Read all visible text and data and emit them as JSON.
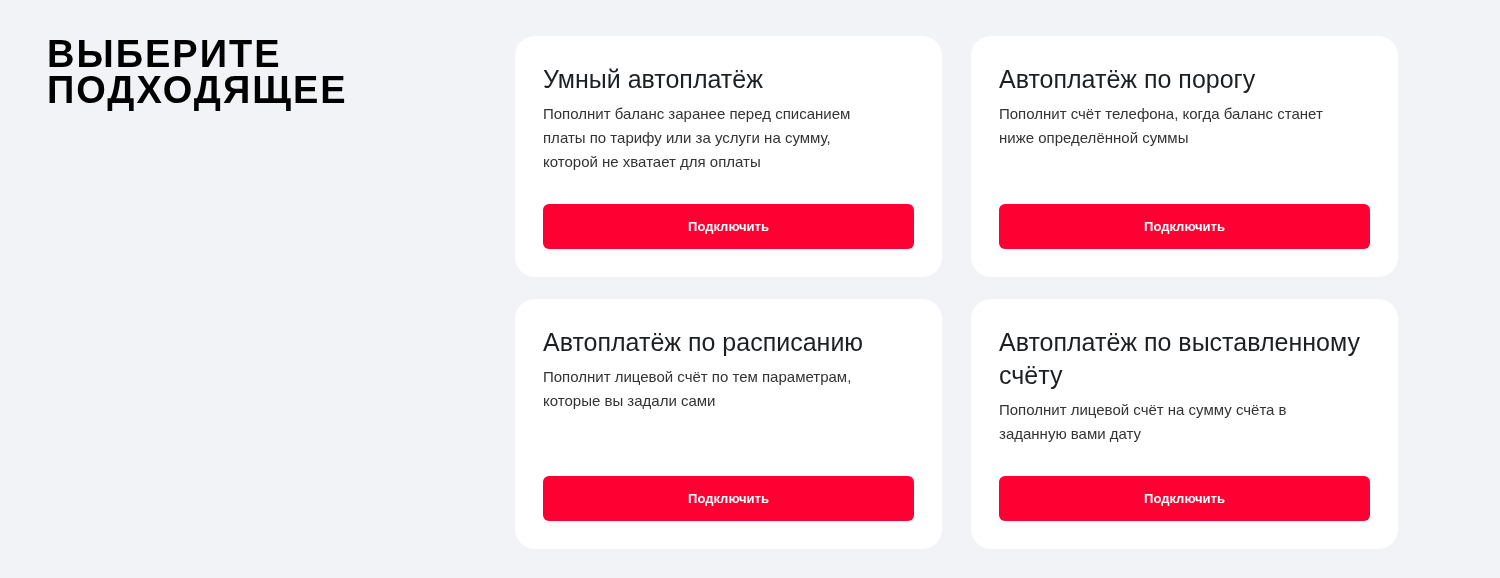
{
  "heading": [
    "ВЫБЕРИТЕ",
    "ПОДХОДЯЩЕЕ"
  ],
  "cards": [
    {
      "title": "Умный автоплатёж",
      "description": "Пополнит баланс заранее перед списанием платы по тарифу или за услуги на сумму, которой не хватает для оплаты",
      "button": "Подключить"
    },
    {
      "title": "Автоплатёж по порогу",
      "description": "Пополнит счёт телефона, когда баланс станет ниже определённой суммы",
      "button": "Подключить"
    },
    {
      "title": "Автоплатёж по расписанию",
      "description": "Пополнит лицевой счёт по тем параметрам, которые вы задали сами",
      "button": "Подключить"
    },
    {
      "title": "Автоплатёж по выставленному счёту",
      "description": "Пополнит лицевой счёт на сумму счёта в заданную вами дату",
      "button": "Подключить"
    }
  ]
}
